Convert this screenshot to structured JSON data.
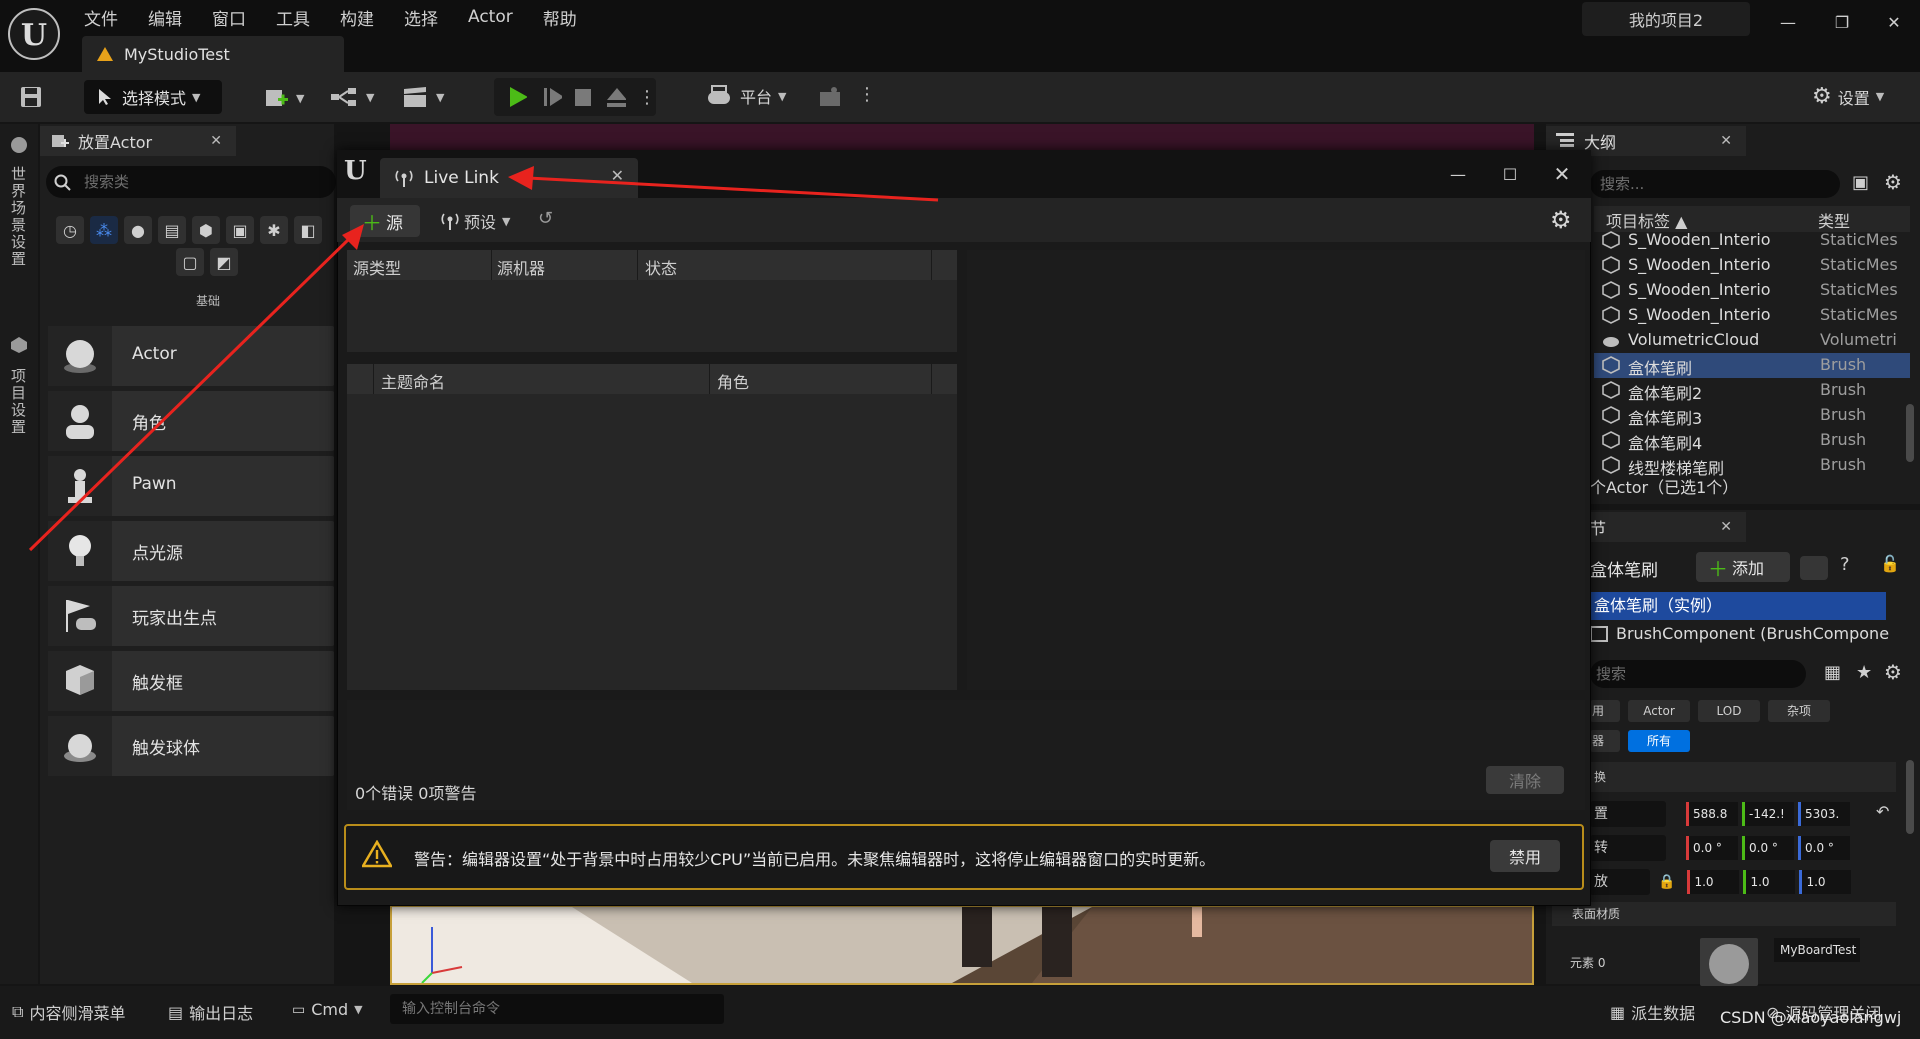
{
  "menu": [
    "文件",
    "编辑",
    "窗口",
    "工具",
    "构建",
    "选择",
    "Actor",
    "帮助"
  ],
  "document_tab": "MyStudioTest",
  "project_name": "我的项目2",
  "toolbar": {
    "mode": "选择模式",
    "platform": "平台",
    "settings": "设置"
  },
  "left_strip": {
    "world_settings": "世界场景设置",
    "project_settings": "项目设置"
  },
  "place_actor": {
    "tab_title": "放置Actor",
    "search_placeholder": "搜索类",
    "category_label": "基础",
    "items": [
      "Actor",
      "角色",
      "Pawn",
      "点光源",
      "玩家出生点",
      "触发框",
      "触发球体"
    ]
  },
  "outliner": {
    "tab_title": "大纲",
    "search_placeholder": "搜索...",
    "col_label": "项目标签 ▲",
    "col_type": "类型",
    "rows": [
      {
        "name": "S_Wooden_Interio",
        "type": "StaticMes"
      },
      {
        "name": "S_Wooden_Interio",
        "type": "StaticMes"
      },
      {
        "name": "S_Wooden_Interio",
        "type": "StaticMes"
      },
      {
        "name": "S_Wooden_Interio",
        "type": "StaticMes"
      },
      {
        "name": "VolumetricCloud",
        "type": "Volumetri"
      },
      {
        "name": "盒体笔刷",
        "type": "Brush"
      },
      {
        "name": "盒体笔刷2",
        "type": "Brush"
      },
      {
        "name": "盒体笔刷3",
        "type": "Brush"
      },
      {
        "name": "盒体笔刷4",
        "type": "Brush"
      },
      {
        "name": "线型楼梯笔刷",
        "type": "Brush"
      }
    ],
    "footer": "个Actor（已选1个）"
  },
  "details": {
    "tab_title": "节",
    "object_name": "盒体笔刷",
    "add_label": "添加",
    "instance_label": "盒体笔刷（实例）",
    "component_label": "BrushComponent (BrushCompone",
    "search_placeholder": "搜索",
    "filters": [
      "用",
      "Actor",
      "LOD",
      "杂项"
    ],
    "filters2": [
      "器",
      "所有"
    ],
    "section": "换",
    "location": {
      "label": "置",
      "x": "588.8",
      "y": "-142.!",
      "z": "5303."
    },
    "rotation": {
      "label": "转",
      "x": "0.0 °",
      "y": "0.0 °",
      "z": "0.0 °"
    },
    "scale": {
      "label": "放",
      "x": "1.0",
      "y": "1.0",
      "z": "1.0"
    },
    "surface_material": "表面材质",
    "element_label": "元素 0",
    "material_name": "MyBoardTest"
  },
  "live_link": {
    "tab_title": "Live Link",
    "add_source": "源",
    "presets": "预设",
    "source_headers": [
      "源类型",
      "源机器",
      "状态"
    ],
    "subject_headers": [
      "主题命名",
      "角色"
    ],
    "status": "0个错误  0项警告",
    "clear": "清除",
    "warning": "警告：编辑器设置“处于背景中时占用较少CPU”当前已启用。未聚焦编辑器时，这将停止编辑器窗口的实时更新。",
    "disable": "禁用"
  },
  "statusbar": {
    "content_drawer": "内容侧滑菜单",
    "output_log": "输出日志",
    "cmd": "Cmd",
    "cmd_placeholder": "输入控制台命令",
    "derived_data": "派生数据",
    "source_control": "源码管理关闭",
    "watermark": "CSDN @xiaoyaolangwj"
  },
  "colors": {
    "arrow": "#e8231e",
    "accent": "#0070e0",
    "play": "#4cbb17",
    "warning_border": "#b98d1a"
  }
}
